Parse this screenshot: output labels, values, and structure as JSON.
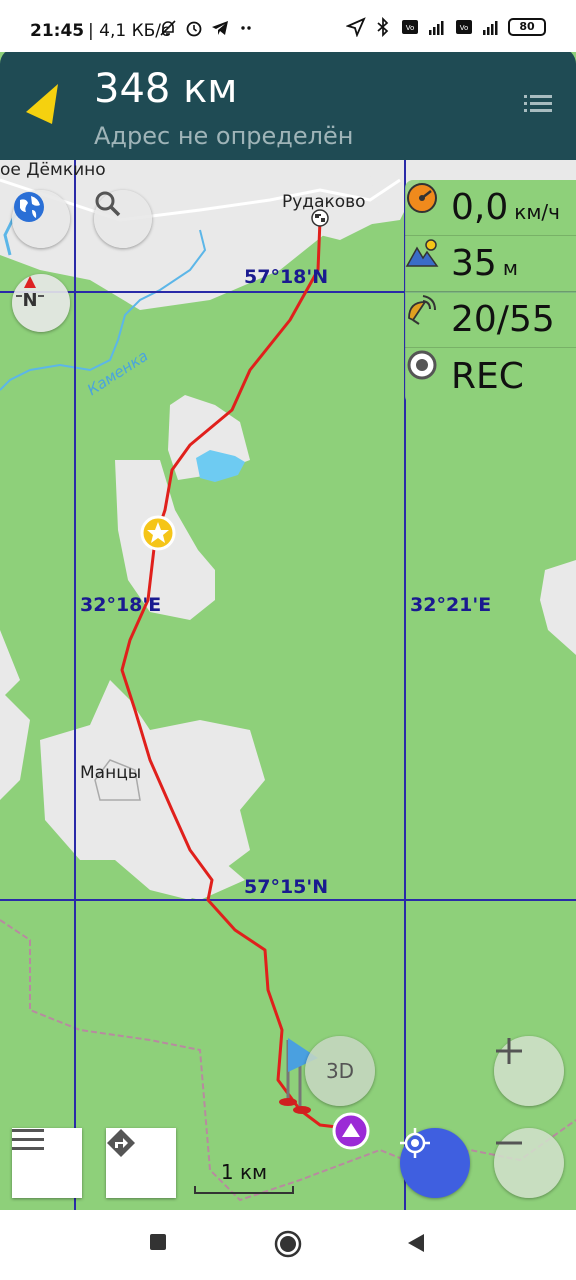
{
  "status_bar": {
    "time": "21:45",
    "speed": "| 4,1 КБ/с",
    "icons_left": [
      "muted-bell-icon",
      "alarm-icon",
      "telegram-icon",
      "more-dots-icon"
    ],
    "icons_right": [
      "location-arrow-icon",
      "bluetooth-icon",
      "volte-icon",
      "signal-4g-icon",
      "volte-icon",
      "signal-icon",
      "battery-icon"
    ],
    "battery": "80"
  },
  "header": {
    "distance": "348 км",
    "address": "Адрес не определён"
  },
  "map": {
    "grid_labels": {
      "lat_top": "57°18'N",
      "lat_bottom": "57°15'N",
      "lon_left": "32°18'E",
      "lon_right": "32°21'E"
    },
    "places": {
      "village_top": "Рудаково",
      "village_left": "ое Дёмкино",
      "village_mid": "Манцы",
      "river": "Каменка"
    }
  },
  "widgets": {
    "speed_value": "0,0",
    "speed_unit": "км/ч",
    "altitude_value": "35",
    "altitude_unit": "м",
    "satellites": "20/55",
    "rec": "REC"
  },
  "buttons": {
    "three_d": "3D"
  },
  "scale": {
    "label": "1 км"
  },
  "colors": {
    "header_bg": "#1f4b54",
    "forest": "#8ed07a",
    "clearing": "#e8e8e8",
    "track": "#e0201c",
    "grid": "#2a2aa8",
    "location_button": "#3f5fe0",
    "nav_arrow": "#f5d10f"
  }
}
